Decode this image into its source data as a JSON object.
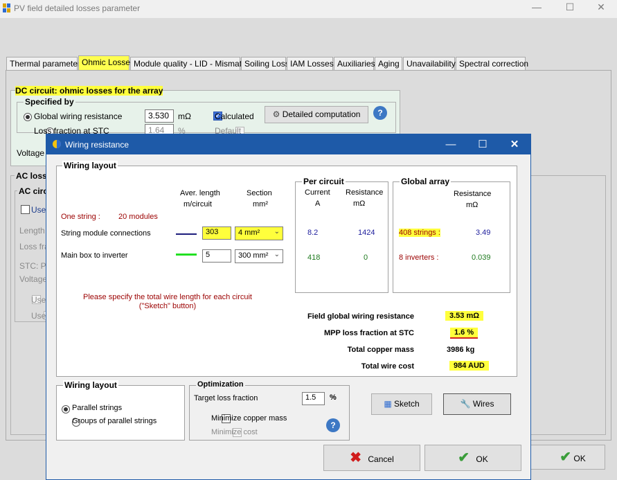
{
  "main_window": {
    "title": "PV field detailed losses parameter",
    "controls": {
      "minimize": "—",
      "maximize": "☐",
      "close": "✕"
    },
    "tabs": [
      {
        "label": "Thermal parameter"
      },
      {
        "label": "Ohmic Losses"
      },
      {
        "label": "Module quality - LID - Mismatch"
      },
      {
        "label": "Soiling Loss"
      },
      {
        "label": "IAM Losses"
      },
      {
        "label": "Auxiliaries"
      },
      {
        "label": "Aging"
      },
      {
        "label": "Unavailability"
      },
      {
        "label": "Spectral correction"
      }
    ],
    "dc_circuit": {
      "title": "DC circuit: ohmic losses for the array",
      "specified_by": "Specified by",
      "global_wiring_label": "Global wiring resistance",
      "global_wiring_value": "3.530",
      "global_wiring_unit": "mΩ",
      "calculated_label": "Calculated",
      "loss_fraction_label": "Loss fraction at STC",
      "loss_fraction_value": "1.64",
      "loss_fraction_unit": "%",
      "default_label": "Default",
      "detailed_button": "Detailed computation",
      "help": "?",
      "voltage_label": "Voltage D"
    },
    "ac": {
      "title": "AC losse",
      "sub_title": "AC circu",
      "uses": "Uses",
      "length": "Length :",
      "loss_frac": "Loss fra",
      "stc": "STC: Pa",
      "voltage": "Voltage",
      "uses2": "Uses",
      "uses3": "Uses"
    },
    "ok_button": "OK"
  },
  "dialog": {
    "title": "Wiring resistance",
    "controls": {
      "minimize": "—",
      "maximize": "☐",
      "close": "✕"
    },
    "wiring_layout": {
      "title": "Wiring layout",
      "col_length": "Aver. length",
      "col_length2": "m/circuit",
      "col_section": "Section",
      "col_section2": "mm²",
      "one_string": "One string :",
      "modules": "20 modules",
      "row1_label": "String module connections",
      "row1_length": "303",
      "row1_section": "4 mm²",
      "row2_label": "Main box to inverter",
      "row2_length": "5",
      "row2_section": "300 mm²",
      "note_line1": "Please specify the total wire length for each circuit",
      "note_line2": "(\"Sketch\" button)"
    },
    "per_circuit": {
      "title": "Per circuit",
      "col_current": "Current",
      "col_current_unit": "A",
      "col_resistance": "Resistance",
      "col_resistance_unit": "mΩ",
      "row1_current": "8.2",
      "row1_resistance": "1424",
      "row2_current": "418",
      "row2_resistance": "0"
    },
    "global_array": {
      "title": "Global array",
      "col_resistance": "Resistance",
      "col_unit": "mΩ",
      "row1_label": "408 strings :",
      "row1_value": "3.49",
      "row2_label": "8 inverters :",
      "row2_value": "0.039"
    },
    "summary": {
      "field_label": "Field global wiring resistance",
      "field_value": "3.53 mΩ",
      "mpp_label": "MPP loss fraction at STC",
      "mpp_value": "1.6 %",
      "copper_label": "Total copper mass",
      "copper_value": "3986 kg",
      "cost_label": "Total wire cost",
      "cost_value": "984 AUD"
    },
    "layout_choice": {
      "title": "Wiring layout",
      "option1": "Parallel strings",
      "option2": "Groups of parallel strings"
    },
    "optimization": {
      "title": "Optimization",
      "target_label": "Target loss fraction",
      "target_value": "1.5",
      "target_unit": "%",
      "minimize_copper": "Minimize copper mass",
      "minimize_cost": "Minimize cost",
      "help": "?"
    },
    "buttons": {
      "sketch": "Sketch",
      "wires": "Wires",
      "cancel": "Cancel",
      "ok": "OK"
    }
  },
  "colors": {
    "dialog_titlebar": "#1e5aa8",
    "highlight": "#ffff3c",
    "red_text": "#9b0000",
    "blue_text": "#1c1c9c",
    "green_text": "#1e7a1e"
  }
}
